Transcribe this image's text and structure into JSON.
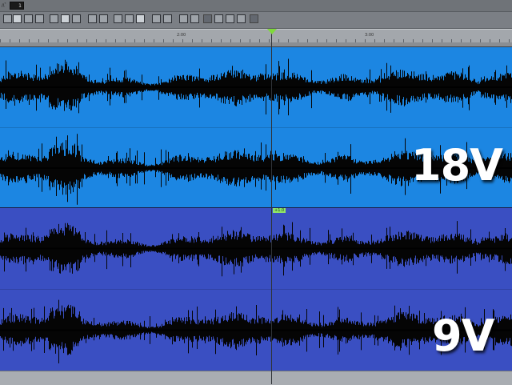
{
  "top": {
    "label": "ﾊﾞ",
    "value": "1"
  },
  "toolbar": {
    "buttons": [
      {
        "name": "tool-1",
        "icon": "grid-icon"
      },
      {
        "name": "tool-2",
        "icon": "grid-icon",
        "active": true
      },
      {
        "name": "tool-3",
        "icon": "snap-icon"
      },
      {
        "name": "tool-4",
        "icon": "range-icon"
      },
      {
        "name": "tool-5",
        "icon": "select-icon"
      },
      {
        "name": "tool-6",
        "icon": "pencil-icon",
        "active": true
      },
      {
        "name": "tool-7",
        "icon": "draw-icon"
      },
      {
        "name": "tool-8",
        "icon": "zoom-icon"
      },
      {
        "name": "tool-9",
        "icon": "list-icon"
      },
      {
        "name": "tool-10",
        "icon": "box-icon"
      },
      {
        "name": "tool-11",
        "icon": "box-icon"
      },
      {
        "name": "tool-12",
        "icon": "toggle-icon",
        "active": true
      },
      {
        "name": "tool-13",
        "icon": "sort-icon"
      },
      {
        "name": "tool-14",
        "icon": "list-icon"
      },
      {
        "name": "tool-15",
        "icon": "expand-icon"
      },
      {
        "name": "tool-16",
        "icon": "fit-icon"
      },
      {
        "name": "tool-17",
        "icon": "blank-icon",
        "dark": true
      },
      {
        "name": "tool-18",
        "icon": "box-icon"
      },
      {
        "name": "tool-19",
        "icon": "box-icon"
      },
      {
        "name": "tool-20",
        "icon": "box-icon"
      },
      {
        "name": "tool-21",
        "icon": "blank-icon",
        "dark": true
      }
    ]
  },
  "ruler": {
    "labels": [
      "2:00",
      "3:00"
    ]
  },
  "playhead": {
    "tag": "+1.0"
  },
  "tracks": [
    {
      "label": "18V",
      "color": "#1c86e2"
    },
    {
      "label": "9V",
      "color": "#3a4fc2"
    }
  ]
}
